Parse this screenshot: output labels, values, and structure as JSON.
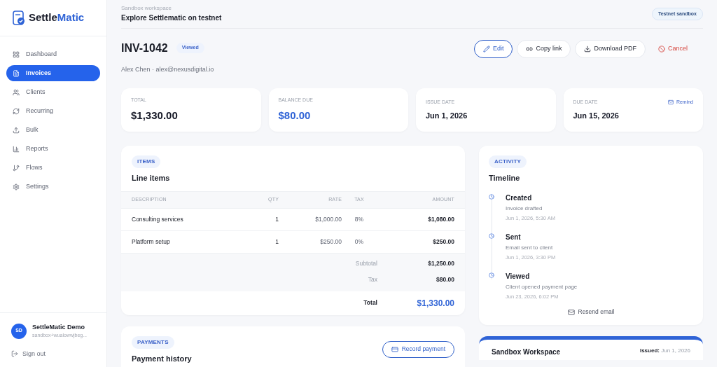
{
  "brand": {
    "name_dark": "Settle",
    "name_accent": "Matic"
  },
  "sidebar": {
    "items": [
      {
        "label": "Dashboard",
        "selected": false
      },
      {
        "label": "Invoices",
        "selected": true
      },
      {
        "label": "Clients",
        "selected": false
      },
      {
        "label": "Recurring",
        "selected": false
      },
      {
        "label": "Bulk",
        "selected": false
      },
      {
        "label": "Reports",
        "selected": false
      },
      {
        "label": "Flows",
        "selected": false
      },
      {
        "label": "Settings",
        "selected": false
      }
    ],
    "user": {
      "initials": "SD",
      "name": "SettleMatic Demo",
      "email": "sandbox+wualowwjbeg..."
    },
    "sign_out": "Sign out"
  },
  "header": {
    "eyebrow": "Sandbox workspace",
    "title": "Explore Settlematic on testnet",
    "badge": "Testnet sandbox"
  },
  "invoice": {
    "number": "INV-1042",
    "status": "Viewed",
    "client": "Alex Chen · alex@nexusdigital.io",
    "actions": [
      {
        "label": "Edit",
        "kind": "primary"
      },
      {
        "label": "Copy link",
        "kind": "default"
      },
      {
        "label": "Download PDF",
        "kind": "default"
      },
      {
        "label": "Cancel",
        "kind": "danger"
      }
    ]
  },
  "stats": [
    {
      "label": "TOTAL",
      "value": "$1,330.00",
      "accent": false
    },
    {
      "label": "BALANCE DUE",
      "value": "$80.00",
      "accent": true
    },
    {
      "label": "ISSUE DATE",
      "value": "Jun 1, 2026",
      "accent": false
    },
    {
      "label": "DUE DATE",
      "value": "Jun 15, 2026",
      "accent": false,
      "action": "Remind"
    }
  ],
  "items_card": {
    "tag": "ITEMS",
    "title": "Line items",
    "columns": [
      "DESCRIPTION",
      "QTY",
      "RATE",
      "TAX",
      "AMOUNT"
    ],
    "rows": [
      [
        "Consulting services",
        "1",
        "$1,000.00",
        "8%",
        "$1,080.00"
      ],
      [
        "Platform setup",
        "1",
        "$250.00",
        "0%",
        "$250.00"
      ]
    ],
    "subtotal_label": "Subtotal",
    "subtotal": "$1,250.00",
    "tax_label": "Tax",
    "tax": "$80.00",
    "total_label": "Total",
    "total": "$1,330.00"
  },
  "payments_card": {
    "tag": "PAYMENTS",
    "title": "Payment history",
    "action": "Record payment"
  },
  "activity_card": {
    "tag": "ACTIVITY",
    "title": "Timeline",
    "events": [
      {
        "title": "Created",
        "detail": "Invoice drafted",
        "time": "Jun 1, 2026, 5:30 AM"
      },
      {
        "title": "Sent",
        "detail": "Email sent to client",
        "time": "Jun 1, 2026, 3:30 PM"
      },
      {
        "title": "Viewed",
        "detail": "Client opened payment page",
        "time": "Jun 23, 2026, 6:02 PM"
      }
    ],
    "action": "Resend email"
  },
  "preview_card": {
    "title": "Sandbox Workspace",
    "issued_label": "Issued:",
    "issued": "Jun 1, 2026"
  }
}
